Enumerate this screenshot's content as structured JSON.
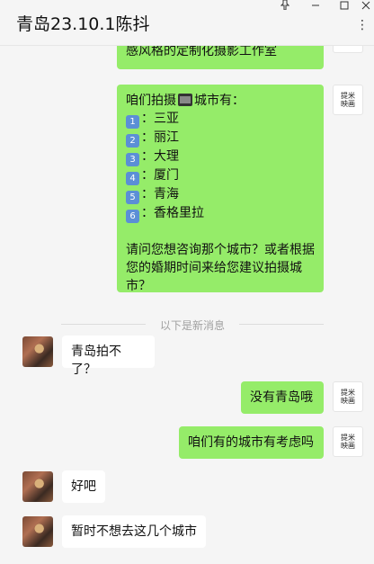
{
  "window": {
    "title": "青岛23.10.1陈抖",
    "pin_icon": "pin-icon",
    "minimize_icon": "minimize-icon",
    "maximize_icon": "maximize-icon",
    "close_icon": "close-icon",
    "more_icon": "more-icon"
  },
  "divider_text": "以下是新消息",
  "messages": {
    "m1": {
      "text": "感风格的定制化摄影工作室"
    },
    "m2": {
      "intro_a": "咱们拍摄",
      "intro_b": "城市有：",
      "cities": [
        {
          "num": "1",
          "sep": "：",
          "name": "三亚"
        },
        {
          "num": "2",
          "sep": "：",
          "name": "丽江"
        },
        {
          "num": "3",
          "sep": "：",
          "name": "大理"
        },
        {
          "num": "4",
          "sep": "：",
          "name": "厦门"
        },
        {
          "num": "5",
          "sep": "：",
          "name": "青海"
        },
        {
          "num": "6",
          "sep": "：",
          "name": "香格里拉"
        }
      ],
      "question_l1": "请问您想咨询那个城市？或者根据",
      "question_l2": "您的婚期时间来给您建议拍摄城",
      "question_l3": "市？"
    },
    "m3": {
      "text": "青岛拍不了？"
    },
    "m4": {
      "text": "没有青岛哦"
    },
    "m5": {
      "text": "咱们有的城市有考虑吗"
    },
    "m6": {
      "text": "好吧"
    },
    "m7": {
      "text": "暂时不想去这几个城市"
    }
  },
  "business_avatar_text": {
    "l1": "提米",
    "l2": "映画"
  },
  "colors": {
    "sent_bubble": "#95ec69",
    "received_bubble": "#ffffff",
    "background": "#f5f5f5"
  }
}
